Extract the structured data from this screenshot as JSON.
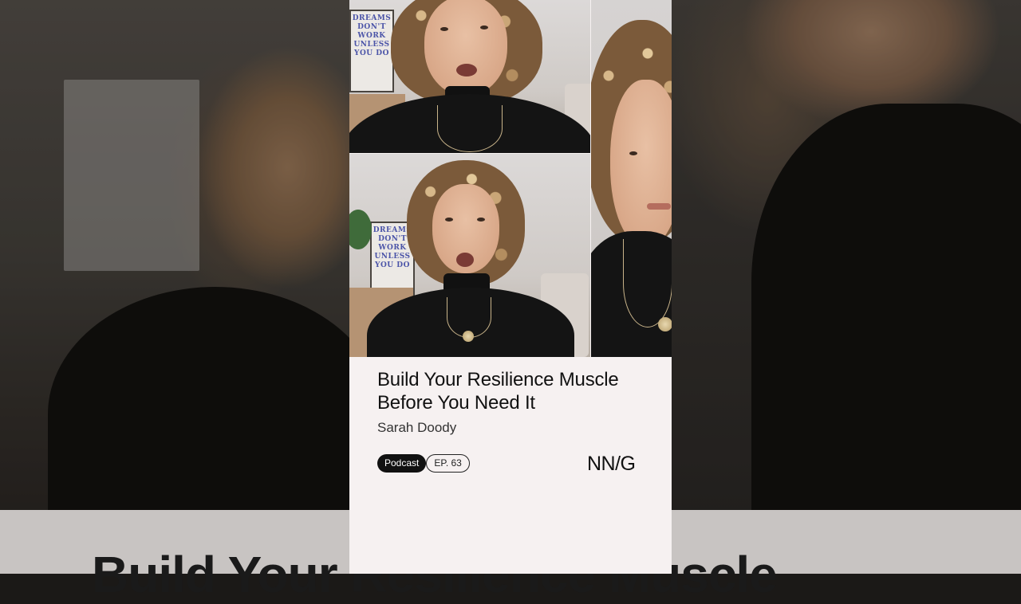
{
  "episode": {
    "title": "Build Your Resilience Muscle Before You Need It",
    "title_line1": "Build Your Resilience Muscle",
    "title_line2": "Before You Need It",
    "author": "Sarah Doody",
    "category_tag": "Podcast",
    "episode_tag": "EP. 63",
    "brand_logo": "NN/G"
  },
  "background": {
    "bottom_text": "Build Your Resilience Muscle"
  },
  "poster": {
    "text": "DREAMS DON'T WORK UNLESS YOU DO"
  },
  "colors": {
    "card_background": "#f6f1f1",
    "tag_fill": "#111111",
    "text": "#111111"
  }
}
